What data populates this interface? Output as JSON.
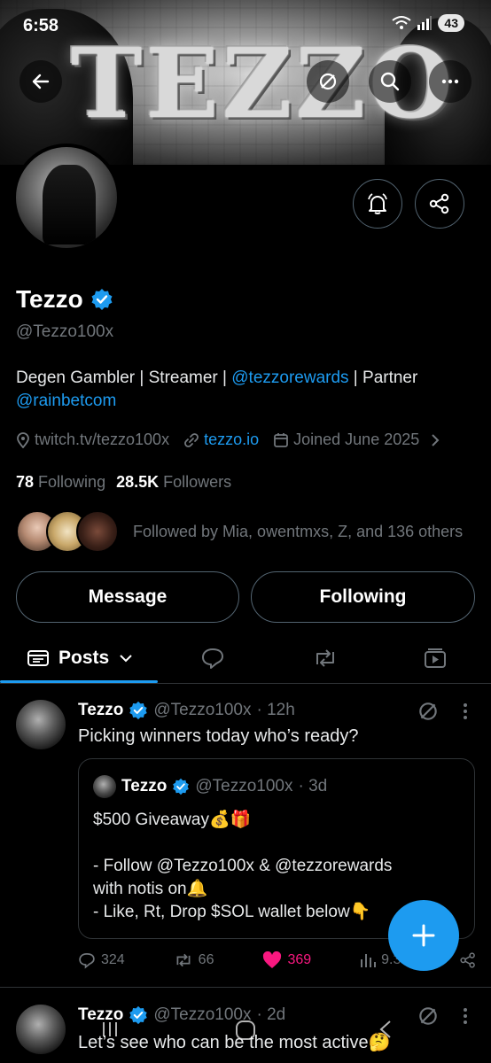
{
  "status_bar": {
    "time": "6:58",
    "battery": "43"
  },
  "banner": {
    "logo_text": "TEZZO"
  },
  "profile": {
    "name": "Tezzo",
    "handle": "@Tezzo100x",
    "bio_prefix": "Degen Gambler | Streamer | ",
    "bio_mention_1": "@tezzorewards",
    "bio_middle": " | Partner ",
    "bio_mention_2": "@rainbetcom",
    "location_link": "twitch.tv/tezzo100x",
    "website": "tezzo.io",
    "joined": "Joined June 2025",
    "following_count": "78",
    "following_label": "Following",
    "followers_count": "28.5K",
    "followers_label": "Followers",
    "followed_by": "Followed by Mia, owentmxs, Z, and 136 others"
  },
  "buttons": {
    "message": "Message",
    "following": "Following"
  },
  "tabs": {
    "posts_label": "Posts"
  },
  "posts": [
    {
      "name": "Tezzo",
      "handle": "@Tezzo100x",
      "time": "· 12h",
      "text": "Picking winners today who’s ready?",
      "quote": {
        "name": "Tezzo",
        "handle": "@Tezzo100x",
        "time": "· 3d",
        "line1": "$500 Giveaway💰🎁",
        "line2": "- Follow @Tezzo100x & @tezzorewards",
        "line3": "with notis on🔔",
        "line4": "- Like, Rt, Drop $SOL wallet below👇"
      },
      "replies": "324",
      "reposts": "66",
      "likes": "369",
      "views": "9.3K"
    },
    {
      "name": "Tezzo",
      "handle": "@Tezzo100x",
      "time": "· 2d",
      "text": "Let’s see who can be the most active🤔"
    }
  ],
  "colors": {
    "accent": "#1d9bf0",
    "like": "#f91880",
    "muted": "#71767b",
    "border": "#2f3336"
  }
}
